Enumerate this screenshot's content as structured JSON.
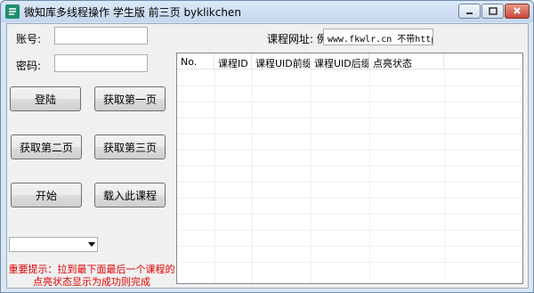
{
  "window": {
    "title": "微知库多线程操作 学生版 前三页 byklikchen"
  },
  "form": {
    "account_label": "账号:",
    "account_value": "",
    "password_label": "密码:",
    "password_value": "",
    "course_url_label": "课程网址: 例:",
    "course_url_value": "www.fkwlr.cn 不带http"
  },
  "buttons": {
    "login": "登陆",
    "page1": "获取第一页",
    "page2": "获取第二页",
    "page3": "获取第三页",
    "start": "开始",
    "load_course": "载入此课程"
  },
  "combo": {
    "value": ""
  },
  "tip": {
    "text": "重要提示：拉到最下面最后一个课程的点亮状态显示为成功则完成"
  },
  "table": {
    "columns": [
      "No.",
      "课程ID",
      "课程UID前缀",
      "课程UID后缀",
      "点亮状态"
    ],
    "rows": []
  },
  "colors": {
    "titlebar": "#c3d6ee",
    "tip_red": "#e00000",
    "app_icon": "#1f8f6e"
  },
  "icons": [
    "app-icon",
    "minimize-icon",
    "maximize-icon",
    "close-icon",
    "chevron-down-icon"
  ]
}
